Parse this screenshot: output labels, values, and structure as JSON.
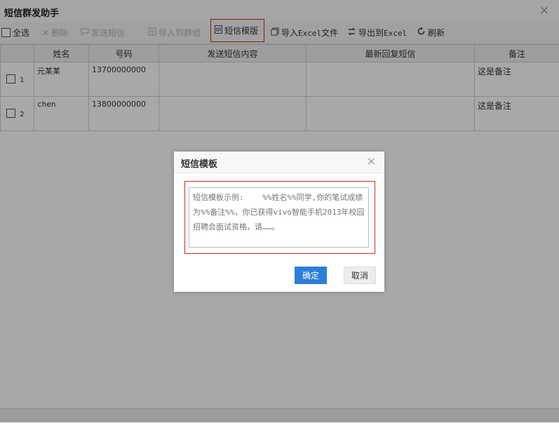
{
  "window": {
    "title": "短信群发助手",
    "close_glyph": "×"
  },
  "toolbar": {
    "select_all": "全选",
    "delete": "删除",
    "send_sms": "发送短信",
    "import_group": "导入到群组",
    "template": "短信模版",
    "import_excel_pre": "导入",
    "import_excel_mono": "Excel",
    "import_excel_post": "文件",
    "export_excel_pre": "导出到",
    "export_excel_mono": "Excel",
    "refresh": "刷新"
  },
  "grid": {
    "columns": [
      "",
      "姓名",
      "号码",
      "发送短信内容",
      "最新回复短信",
      "备注"
    ],
    "rows": [
      {
        "num": "1",
        "name": "元某某",
        "phone": "13700000000",
        "content": "",
        "reply": "",
        "note": "这是备注"
      },
      {
        "num": "2",
        "name": "chen",
        "phone": "13800000000",
        "content": "",
        "reply": "",
        "note": "这是备注"
      }
    ]
  },
  "dialog": {
    "title": "短信模板",
    "close_glyph": "×",
    "placeholder": "短信模板示例:    %%姓名%%同学,你的笔试成绩为%%备注%%，你已获得vivo智能手机2013年校园招聘会面试资格，请……。",
    "ok": "确定",
    "cancel": "取消"
  },
  "icons": {
    "delete": "close-icon",
    "send": "message-icon",
    "import_group": "import-icon",
    "template": "template-icon",
    "import_excel": "copy-icon",
    "export_excel": "swap-icon",
    "refresh": "refresh-icon"
  },
  "colors": {
    "accent": "#2e7dd7",
    "highlight": "#d32a2a",
    "overlay": "#000000"
  }
}
